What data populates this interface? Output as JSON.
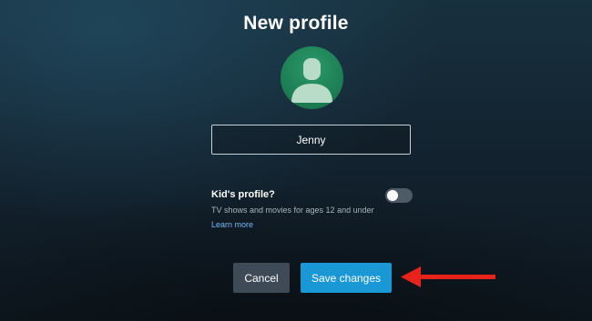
{
  "page": {
    "title": "New profile"
  },
  "avatar": {
    "icon": "person-silhouette-icon",
    "color": "#1e7f55"
  },
  "profile_name": {
    "value": "Jenny",
    "placeholder": ""
  },
  "kids_profile": {
    "label": "Kid's profile?",
    "description": "TV shows and movies for ages 12 and under",
    "learn_more": "Learn more",
    "enabled": false
  },
  "actions": {
    "cancel_label": "Cancel",
    "save_label": "Save changes",
    "save_color": "#1a98d5"
  },
  "annotation": {
    "arrow_color": "#e8231b",
    "arrow_icon": "left-arrow-icon"
  }
}
